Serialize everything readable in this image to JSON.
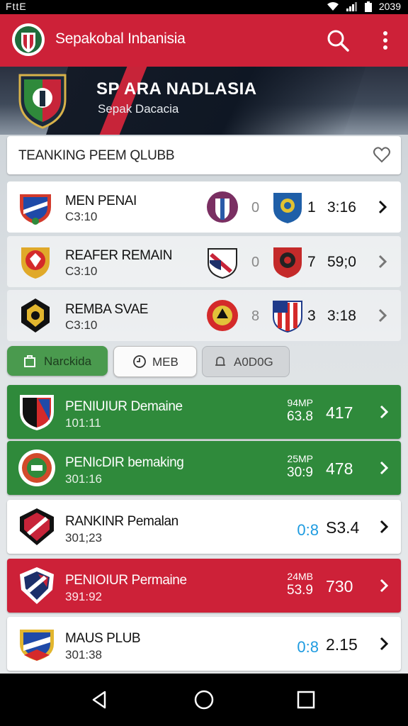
{
  "status_bar": {
    "left": "FttE",
    "time": "2039"
  },
  "app_bar": {
    "title": "Sepakobal Inbanisia"
  },
  "hero": {
    "title": "SP ARA NADLASIA",
    "subtitle": "Sepak Dacacia"
  },
  "section": {
    "title": "TEANKING PEEM QLUBB"
  },
  "matches": [
    {
      "name": "MEN PENAI",
      "time": "C3:10",
      "score1": "0",
      "score2": "1",
      "clock": "3:16"
    },
    {
      "name": "REAFER REMAIN",
      "time": "C3:10",
      "score1": "0",
      "score2": "7",
      "clock": "59;0"
    },
    {
      "name": "REMBA SVAE",
      "time": "C3:10",
      "score1": "8",
      "score2": "3",
      "clock": "3:18"
    }
  ],
  "filters": [
    {
      "label": "Narckida",
      "active": true
    },
    {
      "label": "MEB",
      "active": false
    },
    {
      "label": "A0D0G",
      "active": false
    }
  ],
  "rankings": [
    {
      "name": "PENIUIUR Demaine",
      "sub": "101:11",
      "stat_top": "94MP",
      "stat_bot": "63.8",
      "points": "417",
      "style": "green"
    },
    {
      "name": "PENIcDIR bemaking",
      "sub": "301:16",
      "stat_top": "25MP",
      "stat_bot": "30:9",
      "points": "478",
      "style": "green"
    },
    {
      "name": "RANKINR Pemalan",
      "sub": "301;23",
      "score": "0:8",
      "points": "S3.4",
      "style": "white"
    },
    {
      "name": "PENIOIUR Permaine",
      "sub": "391:92",
      "stat_top": "24MB",
      "stat_bot": "53.9",
      "points": "730",
      "style": "red"
    },
    {
      "name": "MAUS PLUB",
      "sub": "301:38",
      "score": "0:8",
      "points": "2.15",
      "style": "white"
    }
  ],
  "colors": {
    "primary_red": "#cd2138",
    "green": "#2f8a3b",
    "score_blue": "#1e9be0"
  }
}
